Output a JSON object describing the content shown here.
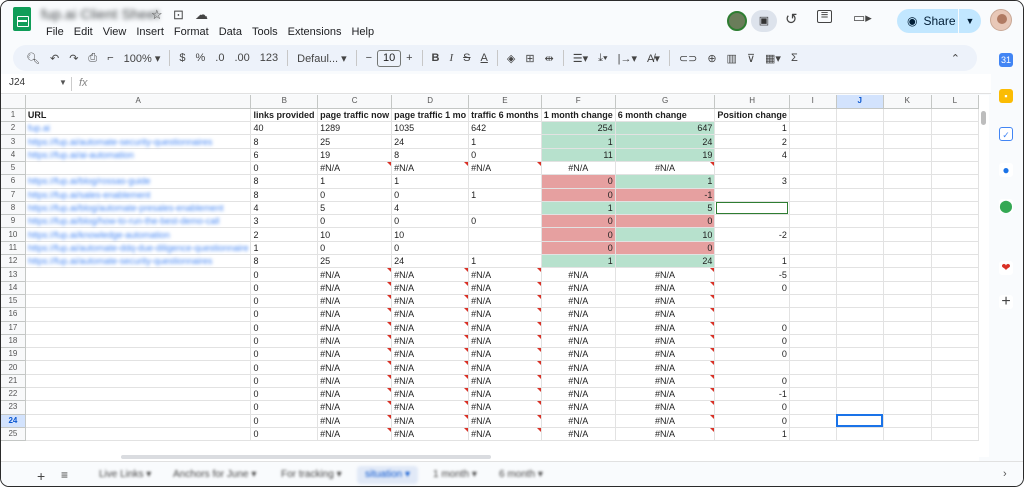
{
  "title_bar": {
    "doc_title": "fup.ai Client Sheet",
    "title_icons": [
      "star-icon",
      "move-icon",
      "cloud-status-icon"
    ],
    "menu": [
      "File",
      "Edit",
      "View",
      "Insert",
      "Format",
      "Data",
      "Tools",
      "Extensions",
      "Help"
    ],
    "share_label": "Share"
  },
  "toolbar": {
    "zoom": "100%",
    "currency": "$",
    "percent": "%",
    "decimal_decrease": ".0",
    "decimal_increase": ".00",
    "number_format": "123",
    "font": "Defaul...",
    "font_size": "10"
  },
  "formula_bar": {
    "name_box": "J24",
    "fx": "fx"
  },
  "columns": [
    "A",
    "B",
    "C",
    "D",
    "E",
    "F",
    "G",
    "H",
    "I",
    "J",
    "K",
    "L"
  ],
  "selected_column": "J",
  "selected_row": "24",
  "rows": [
    {
      "n": "1",
      "cells": [
        "URL",
        "links provided",
        "page traffic now",
        "page traffic 1 mo",
        "traffic 6 months",
        "1 month change",
        "6 month change",
        "Position change",
        "",
        "",
        "",
        ""
      ]
    },
    {
      "n": "2",
      "cells": [
        "fup.ai",
        "40",
        "1289",
        "1035",
        "642",
        "254",
        "647",
        "1",
        "",
        "",
        "",
        ""
      ]
    },
    {
      "n": "3",
      "cells": [
        "https://fup.ai/automate-security-questionnaires",
        "8",
        "25",
        "24",
        "1",
        "1",
        "24",
        "2",
        "",
        "",
        "",
        ""
      ]
    },
    {
      "n": "4",
      "cells": [
        "https://fup.ai/ai-automation",
        "6",
        "19",
        "8",
        "0",
        "11",
        "19",
        "4",
        "",
        "",
        "",
        ""
      ]
    },
    {
      "n": "5",
      "cells": [
        "",
        "0",
        "#N/A",
        "#N/A",
        "#N/A",
        "#N/A",
        "#N/A",
        "",
        "",
        "",
        "",
        ""
      ]
    },
    {
      "n": "6",
      "cells": [
        "https://fup.ai/blog/rossas-guide",
        "8",
        "1",
        "1",
        "",
        "0",
        "1",
        "3",
        "",
        "",
        "",
        ""
      ]
    },
    {
      "n": "7",
      "cells": [
        "https://fup.ai/sales-enablement",
        "8",
        "0",
        "0",
        "1",
        "0",
        "-1",
        "",
        "",
        "",
        "",
        ""
      ]
    },
    {
      "n": "8",
      "cells": [
        "https://fup.ai/blog/automate-presales-enablement",
        "4",
        "5",
        "4",
        "",
        "1",
        "5",
        "",
        "",
        "",
        "",
        ""
      ]
    },
    {
      "n": "9",
      "cells": [
        "https://fup.ai/blog/how-to-run-the-best-demo-call",
        "3",
        "0",
        "0",
        "0",
        "0",
        "0",
        "",
        "",
        "",
        "",
        ""
      ]
    },
    {
      "n": "10",
      "cells": [
        "https://fup.ai/knowledge-automation",
        "2",
        "10",
        "10",
        "",
        "0",
        "10",
        "-2",
        "",
        "",
        "",
        ""
      ]
    },
    {
      "n": "11",
      "cells": [
        "https://fup.ai/automate-ddq-due-diligence-questionnaire",
        "1",
        "0",
        "0",
        "",
        "0",
        "0",
        "",
        "",
        "",
        "",
        ""
      ]
    },
    {
      "n": "12",
      "cells": [
        "https://fup.ai/automate-security-questionnaires",
        "8",
        "25",
        "24",
        "1",
        "1",
        "24",
        "1",
        "",
        "",
        "",
        ""
      ]
    },
    {
      "n": "13",
      "cells": [
        "",
        "0",
        "#N/A",
        "#N/A",
        "#N/A",
        "#N/A",
        "#N/A",
        "-5",
        "",
        "",
        "",
        ""
      ]
    },
    {
      "n": "14",
      "cells": [
        "",
        "0",
        "#N/A",
        "#N/A",
        "#N/A",
        "#N/A",
        "#N/A",
        "0",
        "",
        "",
        "",
        ""
      ]
    },
    {
      "n": "15",
      "cells": [
        "",
        "0",
        "#N/A",
        "#N/A",
        "#N/A",
        "#N/A",
        "#N/A",
        "",
        "",
        "",
        "",
        ""
      ]
    },
    {
      "n": "16",
      "cells": [
        "",
        "0",
        "#N/A",
        "#N/A",
        "#N/A",
        "#N/A",
        "#N/A",
        "",
        "",
        "",
        "",
        ""
      ]
    },
    {
      "n": "17",
      "cells": [
        "",
        "0",
        "#N/A",
        "#N/A",
        "#N/A",
        "#N/A",
        "#N/A",
        "0",
        "",
        "",
        "",
        ""
      ]
    },
    {
      "n": "18",
      "cells": [
        "",
        "0",
        "#N/A",
        "#N/A",
        "#N/A",
        "#N/A",
        "#N/A",
        "0",
        "",
        "",
        "",
        ""
      ]
    },
    {
      "n": "19",
      "cells": [
        "",
        "0",
        "#N/A",
        "#N/A",
        "#N/A",
        "#N/A",
        "#N/A",
        "0",
        "",
        "",
        "",
        ""
      ]
    },
    {
      "n": "20",
      "cells": [
        "",
        "0",
        "#N/A",
        "#N/A",
        "#N/A",
        "#N/A",
        "#N/A",
        "",
        "",
        "",
        "",
        ""
      ]
    },
    {
      "n": "21",
      "cells": [
        "",
        "0",
        "#N/A",
        "#N/A",
        "#N/A",
        "#N/A",
        "#N/A",
        "0",
        "",
        "",
        "",
        ""
      ]
    },
    {
      "n": "22",
      "cells": [
        "",
        "0",
        "#N/A",
        "#N/A",
        "#N/A",
        "#N/A",
        "#N/A",
        "-1",
        "",
        "",
        "",
        ""
      ]
    },
    {
      "n": "23",
      "cells": [
        "",
        "0",
        "#N/A",
        "#N/A",
        "#N/A",
        "#N/A",
        "#N/A",
        "0",
        "",
        "",
        "",
        ""
      ]
    },
    {
      "n": "24",
      "cells": [
        "",
        "0",
        "#N/A",
        "#N/A",
        "#N/A",
        "#N/A",
        "#N/A",
        "0",
        "",
        "",
        "",
        ""
      ]
    },
    {
      "n": "25",
      "cells": [
        "",
        "0",
        "#N/A",
        "#N/A",
        "#N/A",
        "#N/A",
        "#N/A",
        "1",
        "",
        "",
        "",
        ""
      ]
    }
  ],
  "colors": {
    "positive_fill": "#b7e1cd",
    "zero_fill": "#e6a0a0",
    "accent": "#1a73e8"
  },
  "sheet_tabs": [
    "Live Links",
    "Anchors for June",
    "For tracking",
    "situation",
    "1 month",
    "6 month"
  ],
  "active_sheet": "situation",
  "side_panel_icons": [
    "calendar-icon",
    "keep-icon",
    "tasks-icon",
    "contacts-icon",
    "maps-icon",
    "addon-icon",
    "add-icon"
  ]
}
